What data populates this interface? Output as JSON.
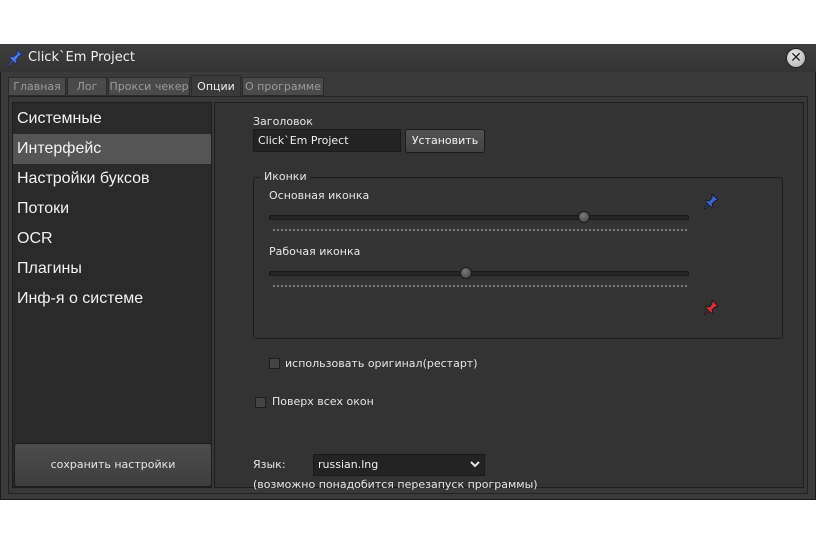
{
  "window": {
    "title": "Click`Em Project"
  },
  "tabs": [
    {
      "label": "Главная"
    },
    {
      "label": "Лог"
    },
    {
      "label": "Прокси чекер"
    },
    {
      "label": "Опции",
      "active": true
    },
    {
      "label": "О программе"
    }
  ],
  "sidebar": {
    "items": [
      {
        "label": "Системные"
      },
      {
        "label": "Интерфейс",
        "selected": true
      },
      {
        "label": "Настройки буксов"
      },
      {
        "label": "Потоки"
      },
      {
        "label": "OCR"
      },
      {
        "label": "Плагины"
      },
      {
        "label": "Инф-я о системе"
      }
    ],
    "save_label": "сохранить настройки"
  },
  "content": {
    "title_label": "Заголовок",
    "title_value": "Click`Em Project",
    "set_label": "Установить",
    "icons_group": {
      "title": "Иконки",
      "main_icon_label": "Основная иконка",
      "main_icon_level": 0.75,
      "main_icon_color": "#3a63d8",
      "work_icon_label": "Рабочая иконка",
      "work_icon_level": 0.47,
      "work_icon_color": "#d8323a",
      "use_original_label": "использовать оригинал(рестарт)",
      "use_original_checked": false
    },
    "on_top_label": "Поверх всех окон",
    "on_top_checked": false,
    "language_label": "Язык:",
    "language_value": "russian.lng",
    "language_note": "(возможно понадобится перезапуск программы)"
  }
}
